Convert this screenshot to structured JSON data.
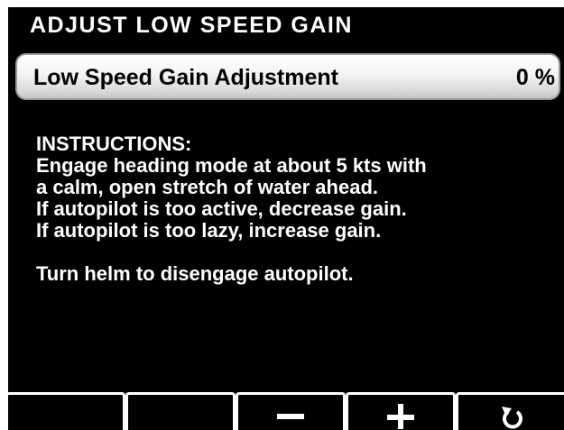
{
  "header": {
    "title": "ADJUST LOW SPEED GAIN"
  },
  "setting": {
    "label": "Low Speed Gain Adjustment",
    "value": "0 %"
  },
  "instructions": {
    "heading": "INSTRUCTIONS:",
    "lines": [
      "Engage heading mode at about 5 kts with",
      "a calm, open stretch of water ahead.",
      "If autopilot is too active, decrease gain.",
      "If autopilot is too lazy, increase gain."
    ],
    "note": "Turn helm to disengage autopilot."
  },
  "softkeys": [
    {
      "icon": "blank"
    },
    {
      "icon": "blank"
    },
    {
      "icon": "minus-icon"
    },
    {
      "icon": "plus-icon"
    },
    {
      "icon": "return-arrow-icon"
    }
  ],
  "colors": {
    "screen_background": "#000000",
    "text": "#ffffff",
    "field_background": "#f0f0f0"
  }
}
